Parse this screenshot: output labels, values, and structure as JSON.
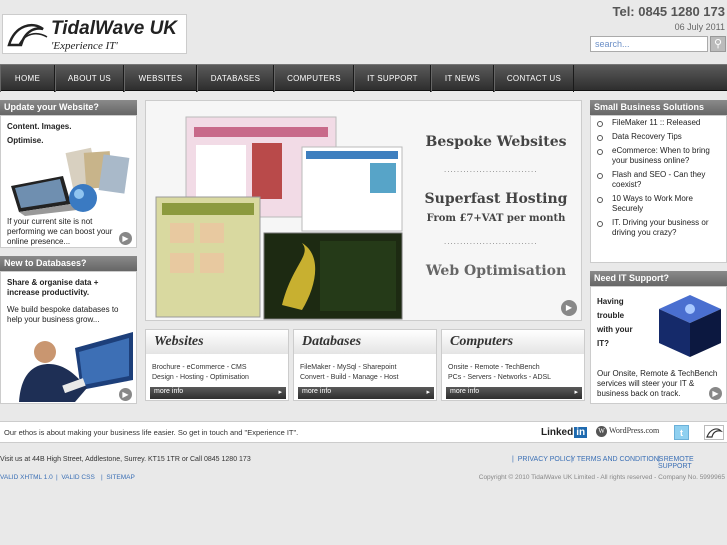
{
  "header": {
    "logo_title": "TidalWave UK",
    "logo_subtitle": "'Experience IT'",
    "phone": "Tel:  0845 1280 173",
    "date": "06 July 2011",
    "search_placeholder": "search..."
  },
  "nav": [
    "HOME",
    "ABOUT US",
    "WEBSITES",
    "DATABASES",
    "COMPUTERS",
    "IT SUPPORT",
    "IT NEWS",
    "CONTACT US"
  ],
  "left": {
    "update": {
      "title": "Update your Website?",
      "line1": "Content. Images.",
      "line2": "Optimise.",
      "body1": "If your current site is not",
      "body2": "performing we can boost your",
      "body3": "online presence..."
    },
    "databases": {
      "title": "New to Databases?",
      "line1": "Share & organise data +",
      "line2": "increase productivity.",
      "body1": "We build bespoke databases to",
      "body2": "help your business grow..."
    }
  },
  "hero": {
    "h1": "Bespoke Websites",
    "h2": "Superfast Hosting",
    "h3": "From £7+VAT per month",
    "h4": "Web Optimisation"
  },
  "boxes": [
    {
      "title": "Websites",
      "line1": "Brochure - eCommerce - CMS",
      "line2": "Design - Hosting - Optimisation",
      "more": "more info"
    },
    {
      "title": "Databases",
      "line1": "FileMaker - MySql - Sharepoint",
      "line2": "Convert - Build - Manage - Host",
      "more": "more info"
    },
    {
      "title": "Computers",
      "line1": "Onsite - Remote - TechBench",
      "line2": "PCs - Servers - Networks - ADSL",
      "more": "more info"
    }
  ],
  "right": {
    "sbs": {
      "title": "Small Business Solutions",
      "items": [
        "FileMaker 11 :: Released",
        "Data Recovery Tips",
        "eCommerce: When to bring your business online?",
        "Flash and SEO - Can they coexist?",
        "10 Ways to Work More Securely",
        "IT. Driving your business or driving you crazy?"
      ]
    },
    "support": {
      "title": "Need IT Support?",
      "l1": "Having",
      "l2": "trouble",
      "l3": "with your",
      "l4": "IT?",
      "body1": "Our Onsite, Remote & TechBench",
      "body2": "services will steer your IT &",
      "body3": "business back on track."
    }
  },
  "ethos": {
    "text": "Our ethos is about making your business life easier. So get in touch and \"Experience IT\".",
    "linkedin": "Linked",
    "linkedin_in": "in",
    "wordpress": "WordPress.com"
  },
  "footer": {
    "address": "Visit us at 44B High Street, Addlestone, Surrey. KT15 1TR or Call 0845 1280 173",
    "privacy": "PRIVACY POLICY",
    "terms": "TERMS AND CONDITIONS",
    "remote": "REMOTE SUPPORT",
    "xhtml": "VALID XHTML 1.0",
    "css": "VALID CSS",
    "sitemap": "SITEMAP",
    "copyright": "Copyright © 2010 TidalWave UK Limited - All rights reserved - Company No. 5999965"
  }
}
